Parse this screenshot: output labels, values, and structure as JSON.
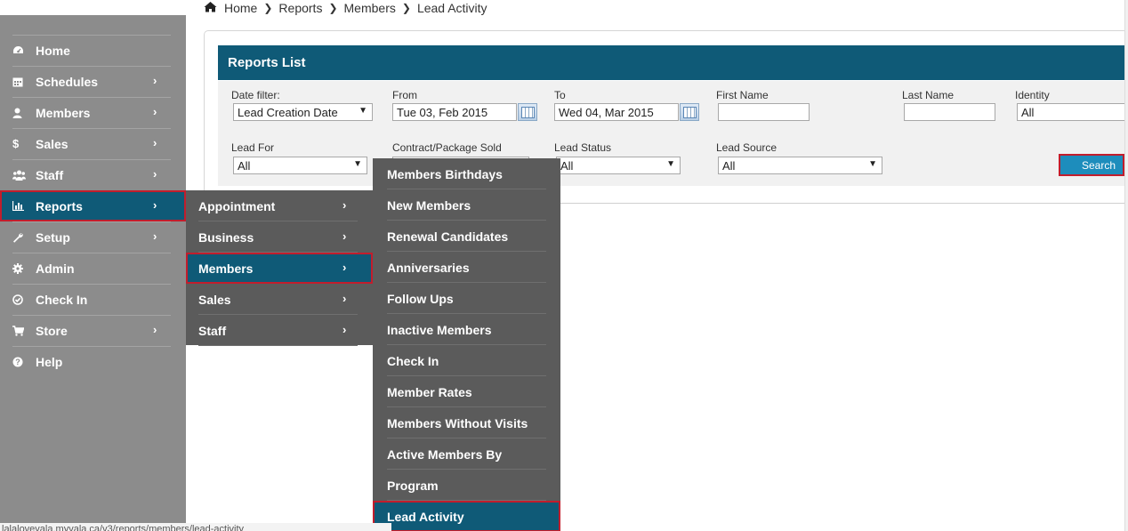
{
  "breadcrumb": {
    "home": "Home",
    "reports": "Reports",
    "members": "Members",
    "current": "Lead Activity"
  },
  "sidebar": {
    "items": [
      {
        "label": "Home",
        "icon": "dashboard-icon",
        "has_submenu": false
      },
      {
        "label": "Schedules",
        "icon": "calendar-icon",
        "has_submenu": true
      },
      {
        "label": "Members",
        "icon": "user-icon",
        "has_submenu": true
      },
      {
        "label": "Sales",
        "icon": "dollar-icon",
        "has_submenu": true
      },
      {
        "label": "Staff",
        "icon": "group-icon",
        "has_submenu": true
      },
      {
        "label": "Reports",
        "icon": "bar-chart-icon",
        "has_submenu": true,
        "active": true
      },
      {
        "label": "Setup",
        "icon": "wrench-icon",
        "has_submenu": true
      },
      {
        "label": "Admin",
        "icon": "gear-icon",
        "has_submenu": false
      },
      {
        "label": "Check In",
        "icon": "check-circle-icon",
        "has_submenu": false
      },
      {
        "label": "Store",
        "icon": "cart-icon",
        "has_submenu": true
      },
      {
        "label": "Help",
        "icon": "question-icon",
        "has_submenu": false
      }
    ]
  },
  "reports_submenu": {
    "items": [
      {
        "label": "Appointment"
      },
      {
        "label": "Business"
      },
      {
        "label": "Members",
        "active": true
      },
      {
        "label": "Sales"
      },
      {
        "label": "Staff"
      }
    ]
  },
  "members_submenu": {
    "items": [
      {
        "label": "Members Birthdays"
      },
      {
        "label": "New Members"
      },
      {
        "label": "Renewal Candidates"
      },
      {
        "label": "Anniversaries"
      },
      {
        "label": "Follow Ups"
      },
      {
        "label": "Inactive Members"
      },
      {
        "label": "Check In"
      },
      {
        "label": "Member Rates"
      },
      {
        "label": "Members Without Visits"
      },
      {
        "label": "Active Members By"
      },
      {
        "label": "Program"
      },
      {
        "label": "Lead Activity",
        "active": true
      }
    ]
  },
  "panel": {
    "title": "Reports List"
  },
  "filters": {
    "date_filter": {
      "label": "Date filter:",
      "value": "Lead Creation Date"
    },
    "from": {
      "label": "From",
      "value": "Tue 03, Feb 2015"
    },
    "to": {
      "label": "To",
      "value": "Wed 04, Mar 2015"
    },
    "first_name": {
      "label": "First Name",
      "value": ""
    },
    "last_name": {
      "label": "Last Name",
      "value": ""
    },
    "identity": {
      "label": "Identity",
      "value": "All"
    },
    "lead_for": {
      "label": "Lead For",
      "value": "All"
    },
    "contract_package": {
      "label": "Contract/Package Sold",
      "value": ""
    },
    "lead_status": {
      "label": "Lead Status",
      "value": "All"
    },
    "lead_source": {
      "label": "Lead Source",
      "value": "All"
    }
  },
  "search_button": "Search",
  "status_url": "lalalovevala.myvala.ca/v3/reports/members/lead-activity",
  "colors": {
    "sidebar_bg": "#8c8c8c",
    "submenu_bg": "#5b5b5b",
    "accent": "#0f5a77",
    "highlight_border": "#c21d2c",
    "button": "#1d8dbc"
  }
}
